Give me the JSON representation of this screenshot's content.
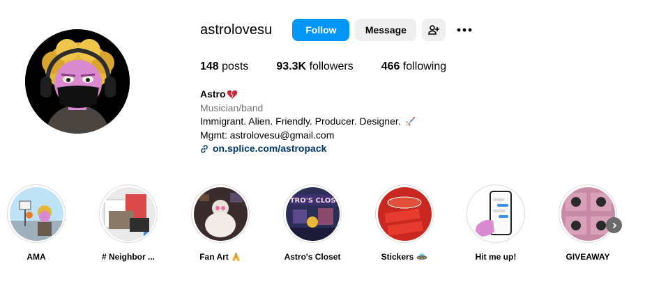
{
  "profile": {
    "username": "astrolovesu",
    "follow_label": "Follow",
    "message_label": "Message",
    "add_user_icon": "person-add-icon",
    "more_icon": "more-options-icon",
    "avatar_icon": "avatar"
  },
  "stats": {
    "posts_count": "148",
    "posts_label": "posts",
    "followers_count": "93.3K",
    "followers_label": "followers",
    "following_count": "466",
    "following_label": "following"
  },
  "bio": {
    "name": "Astro",
    "name_emoji": "heart-emoji",
    "category": "Musician/band",
    "line1": "Immigrant. Alien. Friendly. Producer. Designer.",
    "line1_emoji": "rocket-emoji",
    "line2": "Mgmt: astrolovesu@gmail.com",
    "link": "on.splice.com/astropack",
    "link_icon": "link-icon"
  },
  "highlights": [
    {
      "label": "AMA"
    },
    {
      "label": "# Neighbor ..."
    },
    {
      "label": "Fan Art",
      "emoji": "folded-hands-emoji"
    },
    {
      "label": "Astro's Closet"
    },
    {
      "label": "Stickers",
      "emoji": "ufo-emoji"
    },
    {
      "label": "Hit me up!"
    },
    {
      "label": "GIVEAWAY"
    }
  ],
  "carousel_next_icon": "chevron-right-icon",
  "colors": {
    "follow_blue": "#0095f6",
    "secondary_button": "#efefef",
    "link_blue": "#00376b",
    "category_gray": "#737373"
  }
}
